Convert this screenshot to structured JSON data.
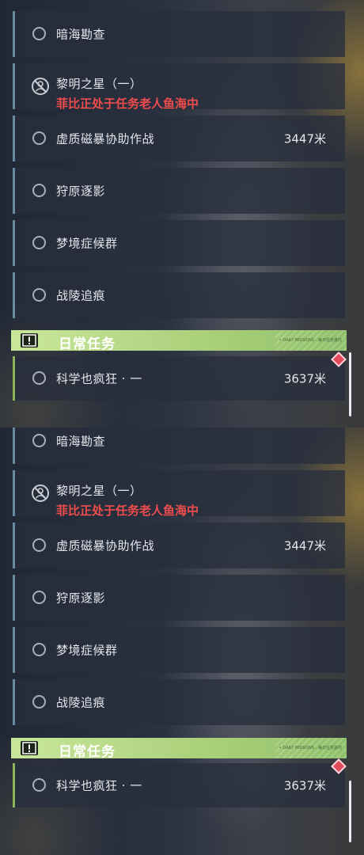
{
  "quests": {
    "q1": {
      "title": "暗海勘查"
    },
    "q2": {
      "title": "黎明之星（一）",
      "status": "菲比正处于任务老人鱼海中"
    },
    "q3": {
      "title": "虚质磁暴协助作战",
      "distance": "3447米"
    },
    "q4": {
      "title": "狩原逐影"
    },
    "q5": {
      "title": "梦境症候群"
    },
    "q6": {
      "title": "战陵追痕"
    }
  },
  "daily": {
    "header": "日常任务",
    "fine_print": "• DAILY MISSIONS · 每日任务委托",
    "quest": {
      "title": "科学也疯狂 · 一",
      "distance": "3637米"
    }
  },
  "colors": {
    "accent_green": "#a9cf7a",
    "warning_red": "#ef4d4d",
    "quest_border": "#6a8aa0"
  }
}
